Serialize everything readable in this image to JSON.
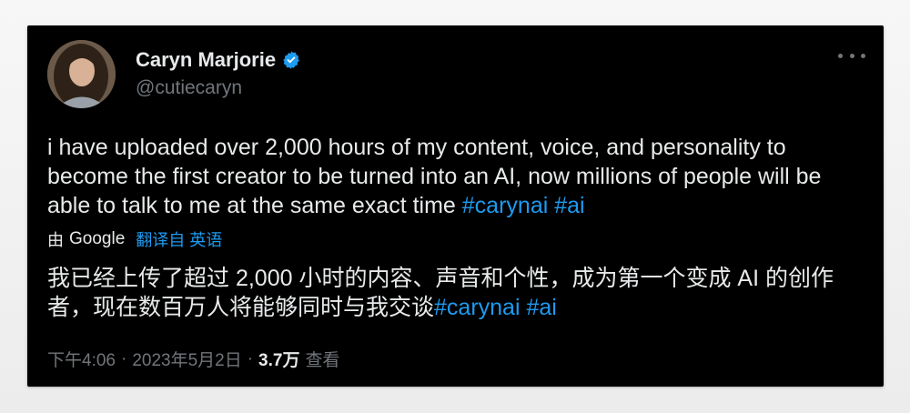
{
  "author": {
    "display_name": "Caryn Marjorie",
    "handle": "@cutiecaryn"
  },
  "tweet": {
    "text": "i have uploaded over 2,000 hours of my content, voice, and personality to become the first creator to be turned into an AI, now millions of people will be able to talk to me at the same exact time ",
    "hashtags": [
      "#carynai",
      "#ai"
    ]
  },
  "translation": {
    "by_label": "由",
    "provider": "Google",
    "link_label": "翻译自 英语",
    "text": "我已经上传了超过 2,000 小时的内容、声音和个性，成为第一个变成 AI 的创作者，现在数百万人将能够同时与我交谈",
    "hashtags": [
      "#carynai",
      "#ai"
    ]
  },
  "meta": {
    "time": "下午4:06",
    "sep1": "·",
    "date": "2023年5月2日",
    "sep2": "·",
    "views_count": "3.7万",
    "views_label": "查看"
  },
  "colors": {
    "background": "#000000",
    "text": "#e7e9ea",
    "secondary": "#71767b",
    "accent": "#1d9bf0"
  },
  "icons": {
    "verified": "verified-badge-icon",
    "more": "more-options-icon"
  }
}
